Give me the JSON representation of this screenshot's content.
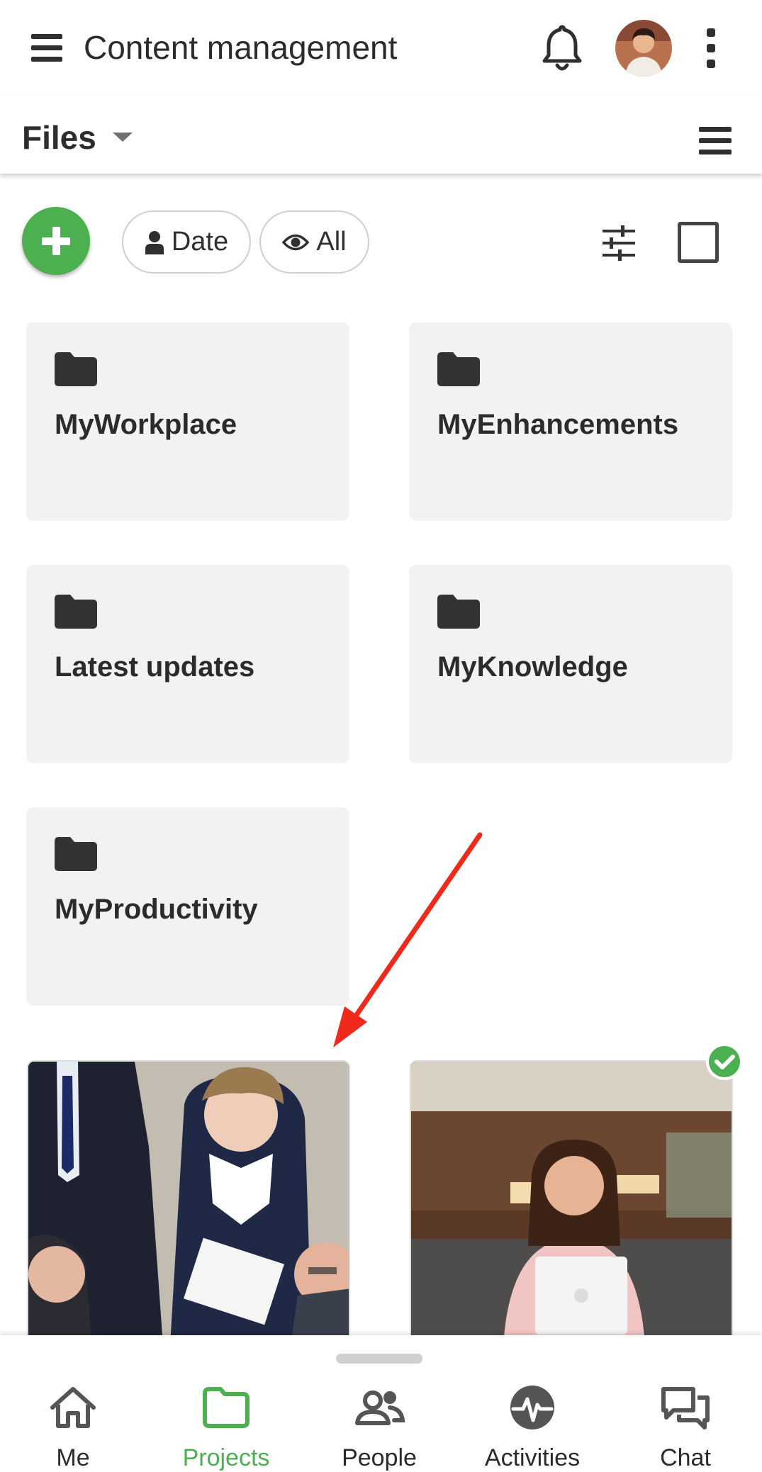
{
  "app": {
    "title": "Content management"
  },
  "toolbar": {
    "section_label": "Files"
  },
  "filters": {
    "date_label": "Date",
    "all_label": "All"
  },
  "folders": [
    {
      "name": "MyWorkplace"
    },
    {
      "name": "MyEnhancements"
    },
    {
      "name": "Latest updates"
    },
    {
      "name": "MyKnowledge"
    },
    {
      "name": "MyProductivity"
    }
  ],
  "nav": {
    "me": "Me",
    "projects": "Projects",
    "people": "People",
    "activities": "Activities",
    "chat": "Chat"
  },
  "colors": {
    "accent": "#4caf50",
    "annotation_arrow": "#f02a1a",
    "folder_bg": "#f2f2f2"
  },
  "icons": [
    "menu-icon",
    "bell-icon",
    "more-vert-icon",
    "caret-down-icon",
    "list-icon",
    "plus-icon",
    "person-icon",
    "eye-icon",
    "tune-icon",
    "checkbox-icon",
    "folder-icon",
    "check-circle-icon",
    "home-icon",
    "people-icon",
    "activity-icon",
    "chat-icon"
  ]
}
